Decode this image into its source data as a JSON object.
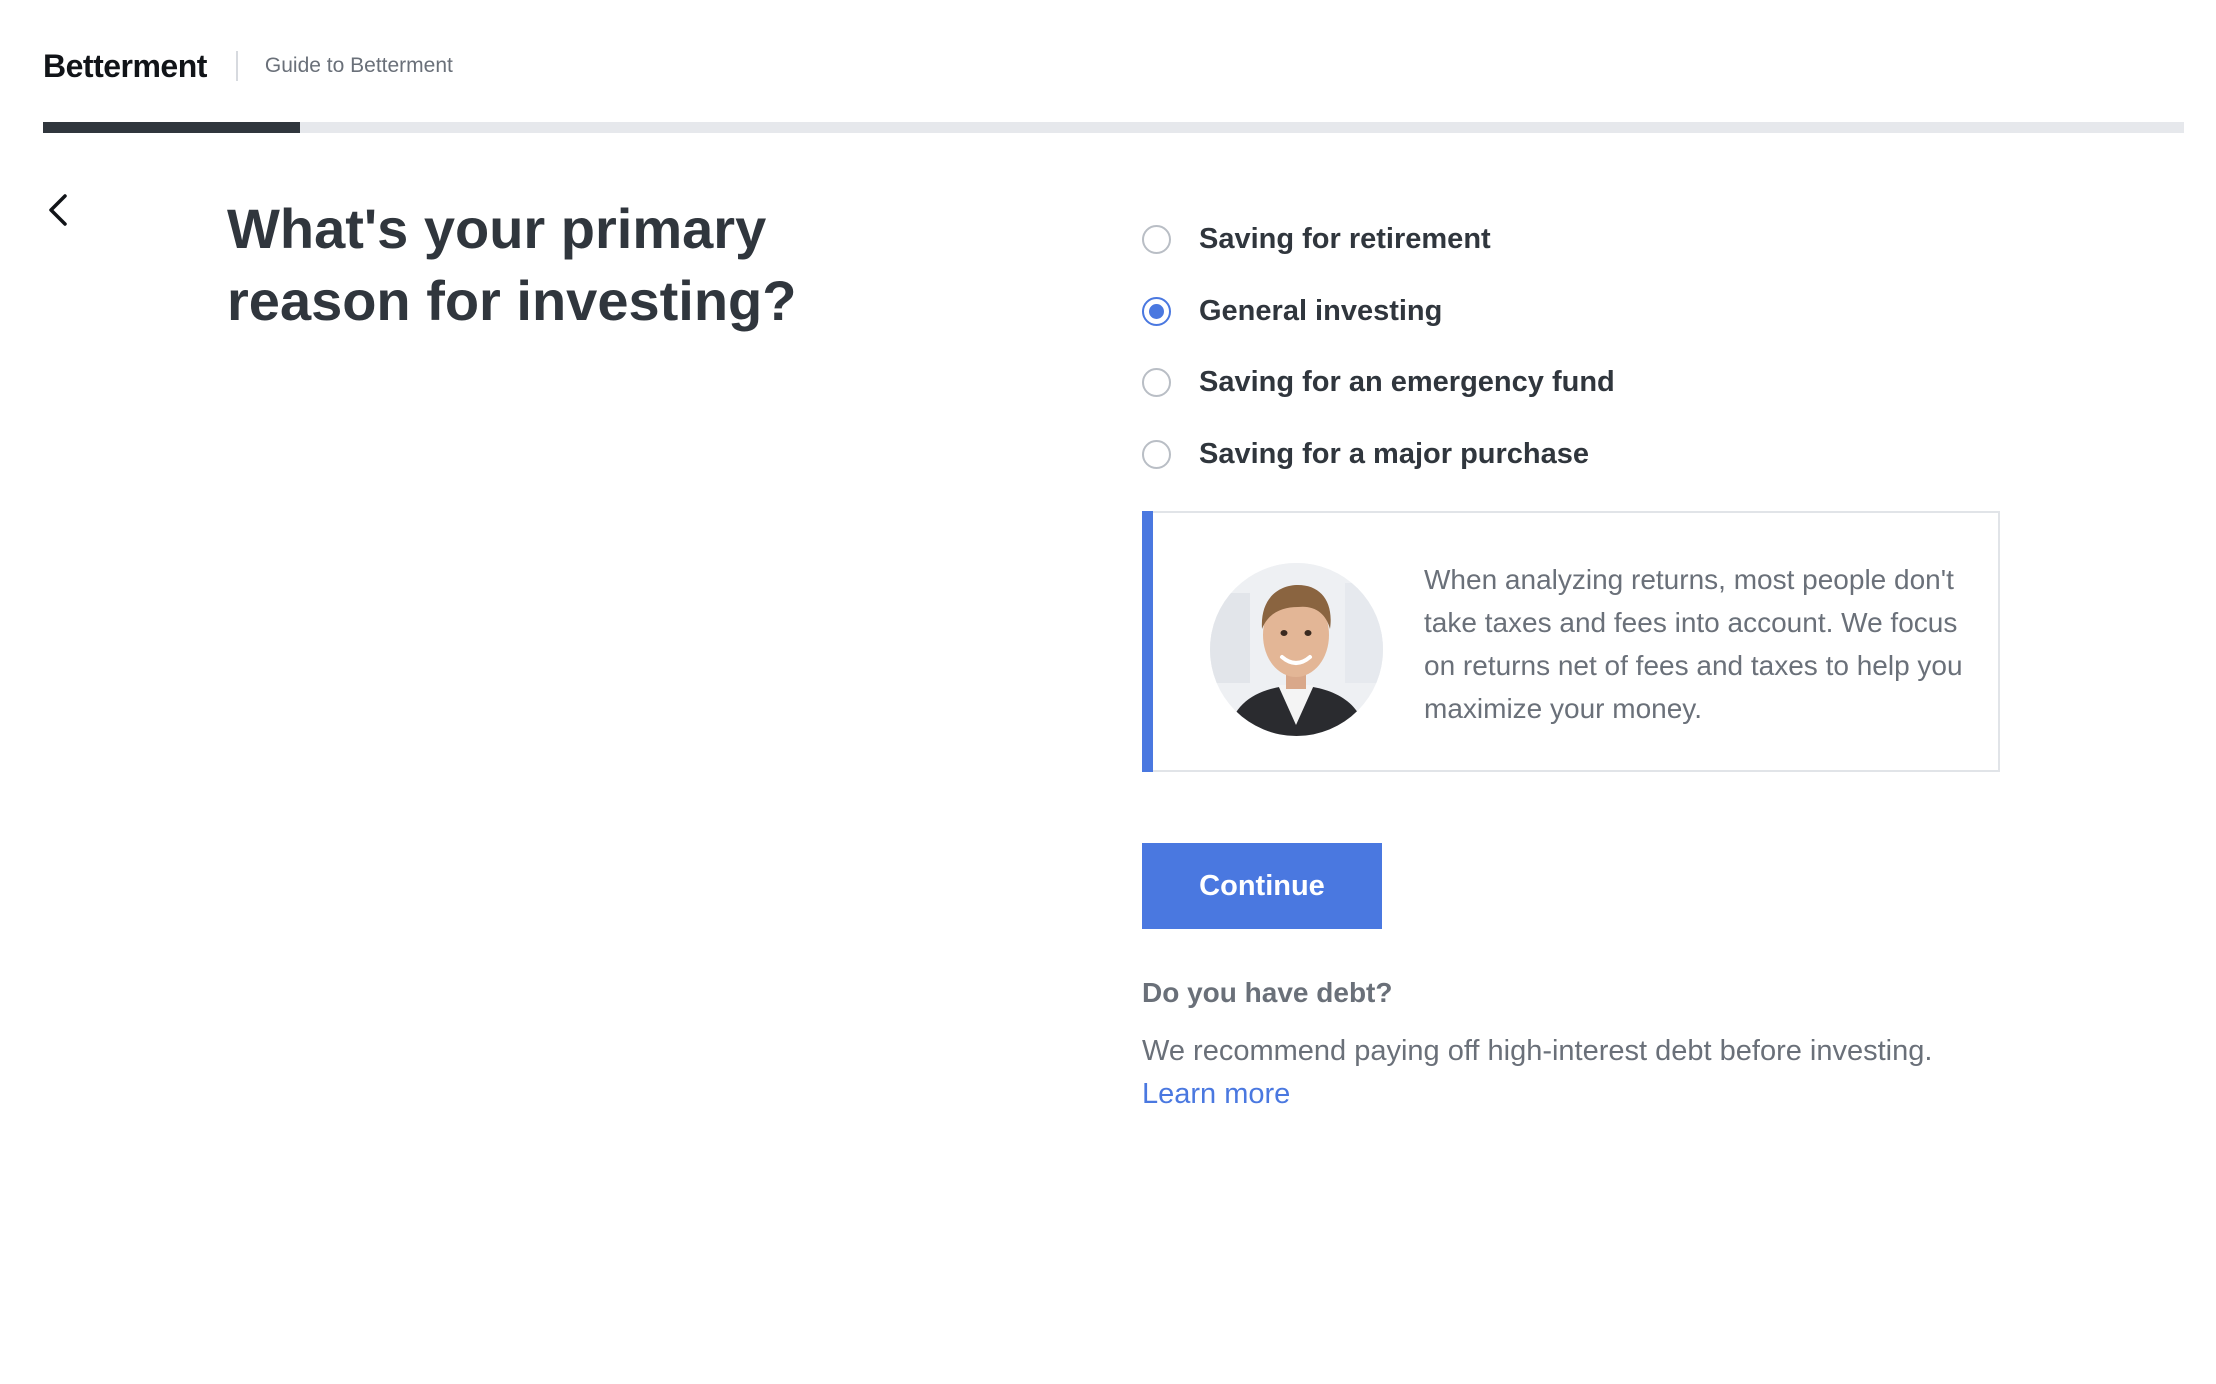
{
  "header": {
    "logo": "Betterment",
    "guide_label": "Guide to Betterment"
  },
  "progress": {
    "value": 0.12
  },
  "question": {
    "line1": "What's your primary",
    "line2": "reason for investing?"
  },
  "options": [
    {
      "label": "Saving for retirement",
      "selected": false
    },
    {
      "label": "General investing",
      "selected": true
    },
    {
      "label": "Saving for an emergency fund",
      "selected": false
    },
    {
      "label": "Saving for a major purchase",
      "selected": false
    }
  ],
  "tip": {
    "text": "When analyzing returns, most people don't take taxes and fees into account. We focus on returns net of fees and taxes to help you maximize your money."
  },
  "continue_label": "Continue",
  "debt": {
    "title": "Do you have debt?",
    "text": "We recommend paying off high-interest debt before investing.",
    "link": "Learn more"
  },
  "colors": {
    "accent": "#4a78e0",
    "text_dark": "#30363d",
    "text_muted": "#6a7079",
    "progress_track": "#e6e8ec",
    "progress_fill": "#30363d"
  },
  "icons": {
    "back": "chevron-left-icon",
    "avatar": "advisor-avatar"
  }
}
